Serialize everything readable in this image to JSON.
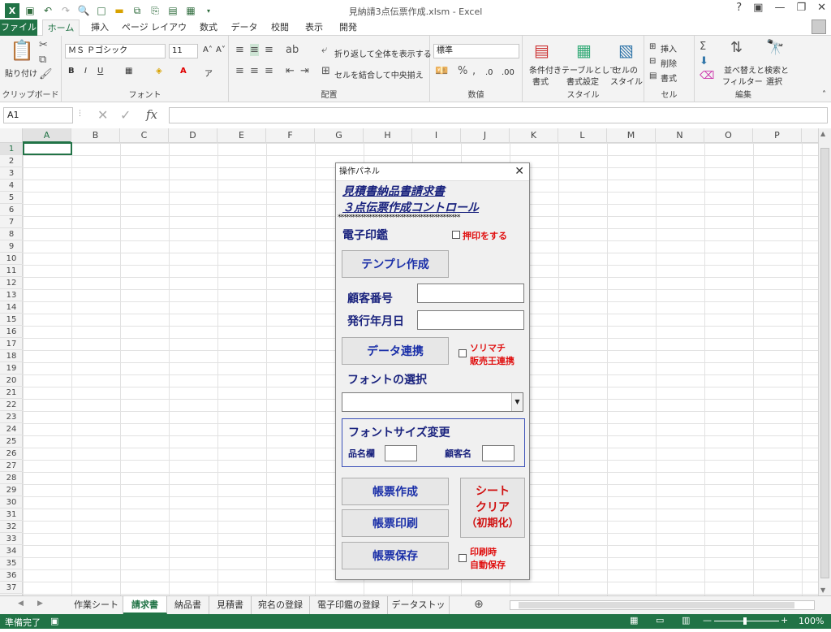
{
  "window": {
    "title": "見納請3点伝票作成.xlsm - Excel"
  },
  "ribbon_tabs": [
    "ファイル",
    "ホーム",
    "挿入",
    "ページ レイアウト",
    "数式",
    "データ",
    "校閲",
    "表示",
    "開発"
  ],
  "ribbon": {
    "clipboard": {
      "paste": "貼り付け",
      "label": "クリップボード"
    },
    "font": {
      "name": "ＭＳ Ｐゴシック",
      "size": "11",
      "label": "フォント"
    },
    "align": {
      "wrap": "折り返して全体を表示する",
      "merge": "セルを結合して中央揃え",
      "label": "配置"
    },
    "number": {
      "format": "標準",
      "label": "数値"
    },
    "style": {
      "cond": "条件付き",
      "cond2": "書式",
      "table": "テーブルとして",
      "table2": "書式設定",
      "cell": "セルの",
      "cell2": "スタイル",
      "label": "スタイル"
    },
    "cells": {
      "insert": "挿入",
      "delete": "削除",
      "format": "書式",
      "label": "セル"
    },
    "edit": {
      "sort": "並べ替えと",
      "sort2": "フィルター",
      "find": "検索と",
      "find2": "選択",
      "label": "編集"
    }
  },
  "formula_bar": {
    "name_box": "A1",
    "fx": "fx",
    "value": ""
  },
  "columns": [
    "A",
    "B",
    "C",
    "D",
    "E",
    "F",
    "G",
    "H",
    "I",
    "J",
    "K",
    "L",
    "M",
    "N",
    "O",
    "P"
  ],
  "rows": [
    "1",
    "2",
    "3",
    "4",
    "5",
    "6",
    "7",
    "8",
    "9",
    "10",
    "11",
    "12",
    "13",
    "14",
    "15",
    "16",
    "17",
    "18",
    "19",
    "20",
    "21",
    "22",
    "23",
    "24",
    "25",
    "26",
    "27",
    "28",
    "29",
    "30",
    "31",
    "32",
    "33",
    "34",
    "35",
    "36",
    "37"
  ],
  "sheet_tabs": [
    "作業シート",
    "請求書",
    "納品書",
    "見積書",
    "宛名の登録",
    "電子印鑑の登録",
    "データストック"
  ],
  "active_sheet": "請求書",
  "status": {
    "ready": "準備完了",
    "zoom": "100%"
  },
  "dialog": {
    "title": "操作パネル",
    "heading1": "見積書納品書請求書",
    "heading2": "３点伝票作成コントロール",
    "stars": "*******************************************",
    "stamp_label": "電子印鑑",
    "stamp_check": "押印をする",
    "template_btn": "テンプレ作成",
    "customer_no": "顧客番号",
    "issue_date": "発行年月日",
    "data_link_btn": "データ連携",
    "solimachi1": "ソリマチ",
    "solimachi2": "販売王連携",
    "font_select": "フォントの選択",
    "font_size": "フォントサイズ変更",
    "item_col": "品名欄",
    "cust_name": "顧客名",
    "create_btn": "帳票作成",
    "print_btn": "帳票印刷",
    "save_btn": "帳票保存",
    "clear1": "シート",
    "clear2": "クリア",
    "clear3": "（初期化）",
    "autosave1": "印刷時",
    "autosave2": "自動保存"
  }
}
